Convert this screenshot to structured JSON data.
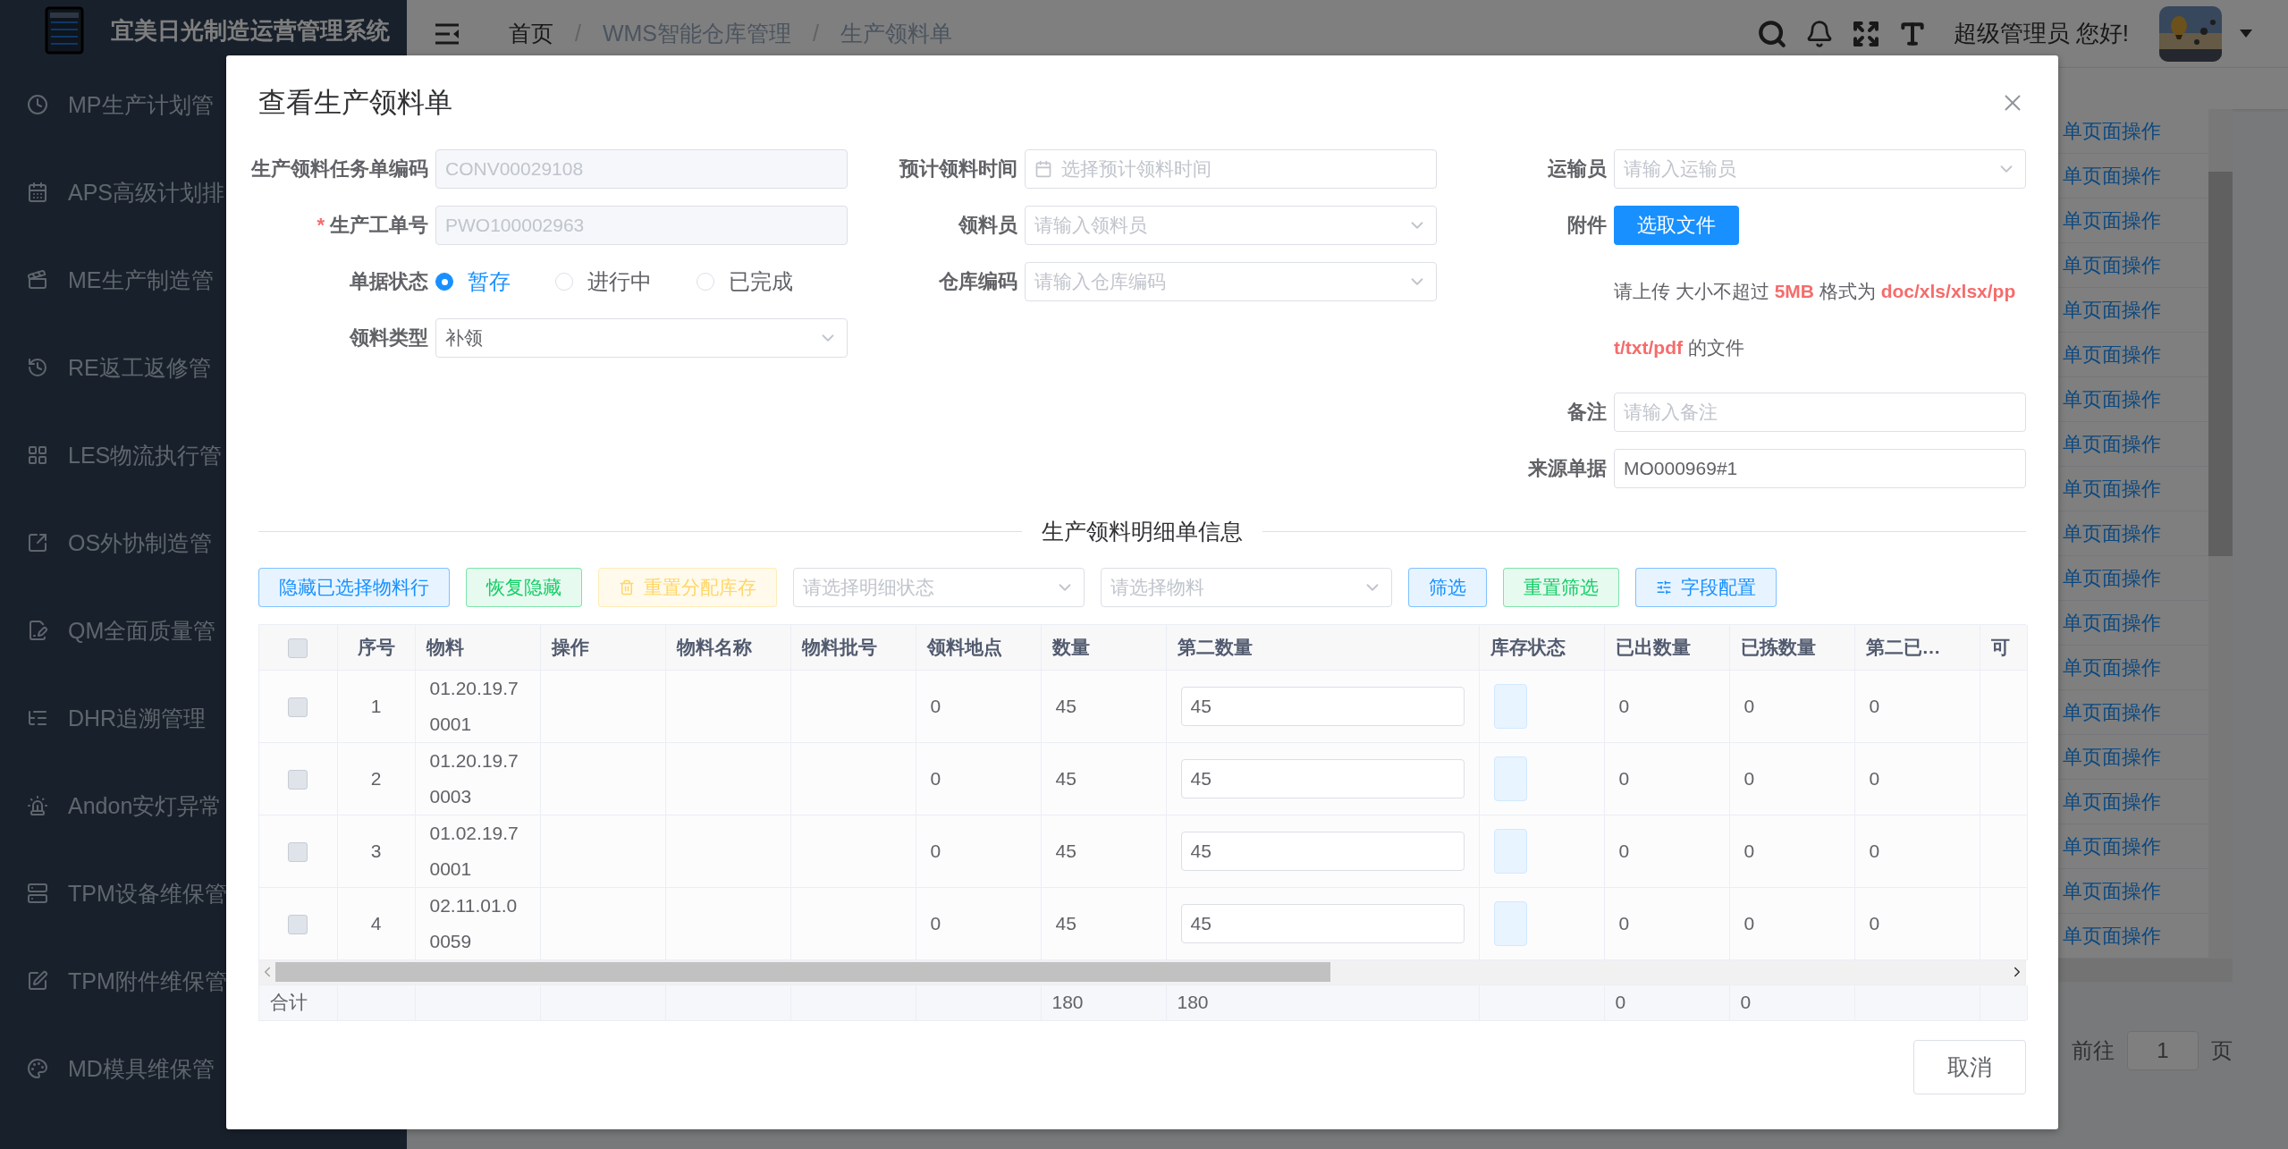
{
  "app": {
    "title": "宜美日光制造运营管理系统"
  },
  "sidebar": {
    "items": [
      {
        "label": "MP生产计划管"
      },
      {
        "label": "APS高级计划排"
      },
      {
        "label": "ME生产制造管"
      },
      {
        "label": "RE返工返修管"
      },
      {
        "label": "LES物流执行管"
      },
      {
        "label": "OS外协制造管"
      },
      {
        "label": "QM全面质量管"
      },
      {
        "label": "DHR追溯管理"
      },
      {
        "label": "Andon安灯异常"
      },
      {
        "label": "TPM设备维保管"
      },
      {
        "label": "TPM附件维保管"
      },
      {
        "label": "MD模具维保管"
      }
    ]
  },
  "header": {
    "breadcrumb": [
      {
        "kind": "link",
        "label": "首页"
      },
      {
        "kind": "text",
        "separator": "/",
        "label": "WMS智能仓库管理"
      },
      {
        "kind": "text",
        "separator": "/",
        "label": "生产领料单"
      }
    ],
    "greeting": "超级管理员 您好!"
  },
  "background": {
    "links": [
      "单页面操作",
      "单页面操作",
      "单页面操作",
      "单页面操作",
      "单页面操作",
      "单页面操作",
      "单页面操作",
      "单页面操作",
      "单页面操作",
      "单页面操作",
      "单页面操作",
      "单页面操作",
      "单页面操作",
      "单页面操作",
      "单页面操作",
      "单页面操作",
      "单页面操作",
      "单页面操作",
      "单页面操作"
    ],
    "pagination": {
      "goto": "前往",
      "page": "1",
      "unit": "页"
    }
  },
  "dialog": {
    "title": "查看生产领料单",
    "form": {
      "columns": [
        [
          {
            "label": "生产领料任务单编码",
            "kind": "input",
            "value": "CONV00029108",
            "disabled": true
          },
          {
            "label": "生产工单号",
            "required_mark": "*",
            "kind": "input",
            "value": "PWO100002963",
            "disabled": true
          },
          {
            "label": "单据状态",
            "kind": "radio",
            "options": [
              {
                "label": "暂存",
                "selected": true
              },
              {
                "label": "进行中",
                "selected": false
              },
              {
                "label": "已完成",
                "selected": false
              }
            ]
          },
          {
            "label": "领料类型",
            "kind": "select",
            "value": "补领"
          }
        ],
        [
          {
            "label": "预计领料时间",
            "kind": "date",
            "placeholder": "选择预计领料时间"
          },
          {
            "label": "领料员",
            "kind": "select",
            "placeholder": "请输入领料员"
          },
          {
            "label": "仓库编码",
            "kind": "select",
            "placeholder": "请输入仓库编码"
          }
        ],
        [
          {
            "label": "运输员",
            "kind": "select",
            "placeholder": "请输入运输员"
          },
          {
            "label": "附件",
            "kind": "upload",
            "button": "选取文件",
            "hint": "请上传 大小不超过 **5MB** 格式为 **doc/xls/xlsx/ppt/txt/pdf** 的文件"
          },
          {
            "label": "备注",
            "kind": "input",
            "placeholder": "请输入备注"
          },
          {
            "label": "来源单据",
            "kind": "input",
            "value": "MO000969#1"
          }
        ]
      ]
    },
    "section_title": "生产领料明细单信息",
    "toolbar": [
      {
        "kind": "button",
        "color": "#1890ff",
        "label": "隐藏已选择物料行",
        "disabled": false
      },
      {
        "kind": "button",
        "color": "#13ce66",
        "label": "恢复隐藏",
        "disabled": false
      },
      {
        "kind": "delete",
        "color": "#ffd666",
        "label": "重置分配库存",
        "disabled": true
      },
      {
        "kind": "select",
        "placeholder": "请选择明细状态"
      },
      {
        "kind": "select",
        "placeholder": "请选择物料"
      },
      {
        "kind": "button",
        "color": "#1890ff",
        "label": "筛选",
        "disabled": false
      },
      {
        "kind": "button",
        "color": "#13ce66",
        "label": "重置筛选",
        "disabled": false
      },
      {
        "kind": "config",
        "color": "#1890ff",
        "label": "字段配置",
        "disabled": false
      }
    ],
    "table": {
      "all_checked": false,
      "columns": [
        "序号",
        "物料",
        "操作",
        "物料名称",
        "物料批号",
        "领料地点",
        "数量",
        "第二数量",
        "库存状态",
        "已出数量",
        "已拣数量",
        "第二已…",
        "可"
      ],
      "rows": [
        {
          "checked": false,
          "index": "1",
          "material": "01.20.19.70001",
          "location": "0",
          "quantity": "45",
          "second_quantity": "45",
          "shipped": "0",
          "picked": "0",
          "second_shipped": "0"
        },
        {
          "checked": false,
          "index": "2",
          "material": "01.20.19.70003",
          "location": "0",
          "quantity": "45",
          "second_quantity": "45",
          "shipped": "0",
          "picked": "0",
          "second_shipped": "0"
        },
        {
          "checked": false,
          "index": "3",
          "material": "01.02.19.70001",
          "location": "0",
          "quantity": "45",
          "second_quantity": "45",
          "shipped": "0",
          "picked": "0",
          "second_shipped": "0"
        },
        {
          "checked": false,
          "index": "4",
          "material": "02.11.01.00059",
          "location": "0",
          "quantity": "45",
          "second_quantity": "45",
          "shipped": "0",
          "picked": "0",
          "second_shipped": "0"
        }
      ],
      "footer": {
        "label": "合计",
        "quantity": "180",
        "second_quantity": "180",
        "shipped": "0",
        "picked": "0"
      }
    },
    "cancel": "取消"
  }
}
